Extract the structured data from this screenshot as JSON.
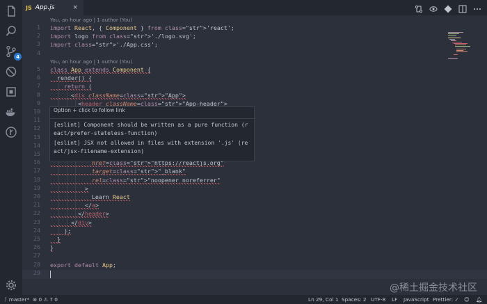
{
  "tab": {
    "icon_label": "JS",
    "filename": "App.js",
    "close": "×"
  },
  "codelens": {
    "first": "You, an hour ago | 1 author (You)",
    "second": "You, an hour ago | 1 author (You)"
  },
  "lines": [
    {
      "n": "1",
      "text": "import React, { Component } from 'react';"
    },
    {
      "n": "2",
      "text": "import logo from './logo.svg';"
    },
    {
      "n": "3",
      "text": "import './App.css';"
    },
    {
      "n": "4",
      "text": ""
    },
    {
      "n": "5",
      "text": "class App extends Component {"
    },
    {
      "n": "6",
      "text": "  render() {"
    },
    {
      "n": "7",
      "text": "    return ("
    },
    {
      "n": "8",
      "text": "      <div className=\"App\">"
    },
    {
      "n": "9",
      "text": "        <header className=\"App-header\">"
    },
    {
      "n": "10",
      "text": ""
    },
    {
      "n": "11",
      "text": ""
    },
    {
      "n": "12",
      "text": ""
    },
    {
      "n": "13",
      "text": ""
    },
    {
      "n": "14",
      "text": ""
    },
    {
      "n": "15",
      "text": ""
    },
    {
      "n": "16",
      "text": "            href=\"https://reactjs.org\""
    },
    {
      "n": "17",
      "text": "            target=\"_blank\""
    },
    {
      "n": "18",
      "text": "            rel=\"noopener noreferrer\""
    },
    {
      "n": "19",
      "text": "          >"
    },
    {
      "n": "20",
      "text": "            Learn React"
    },
    {
      "n": "21",
      "text": "          </a>"
    },
    {
      "n": "22",
      "text": "        </header>"
    },
    {
      "n": "23",
      "text": "      </div>"
    },
    {
      "n": "24",
      "text": "    );"
    },
    {
      "n": "25",
      "text": "  }"
    },
    {
      "n": "26",
      "text": "}"
    },
    {
      "n": "27",
      "text": ""
    },
    {
      "n": "28",
      "text": "export default App;"
    },
    {
      "n": "29",
      "text": ""
    }
  ],
  "hover": {
    "header": "Option + click to follow link",
    "msg1": "[eslint] Component should be written as a pure function (react/prefer-stateless-function)",
    "msg2": "[eslint] JSX not allowed in files with extension '.js' (react/jsx-filename-extension)"
  },
  "activity": {
    "scm_badge": "4"
  },
  "status": {
    "branch": "master*",
    "errors": "0",
    "warnings": "7",
    "infos": "0",
    "position": "Ln 29, Col 1",
    "spaces": "Spaces: 2",
    "encoding": "UTF-8",
    "eol": "LF",
    "language": "JavaScript",
    "prettier": "Prettier: ✓"
  },
  "watermark": "@稀土掘金技术社区",
  "colors": {
    "background": "#2b303b",
    "keyword": "#b48ead",
    "string": "#a3be8c",
    "tag": "#bf616a",
    "class": "#ebcb8b",
    "attr": "#d08770"
  }
}
